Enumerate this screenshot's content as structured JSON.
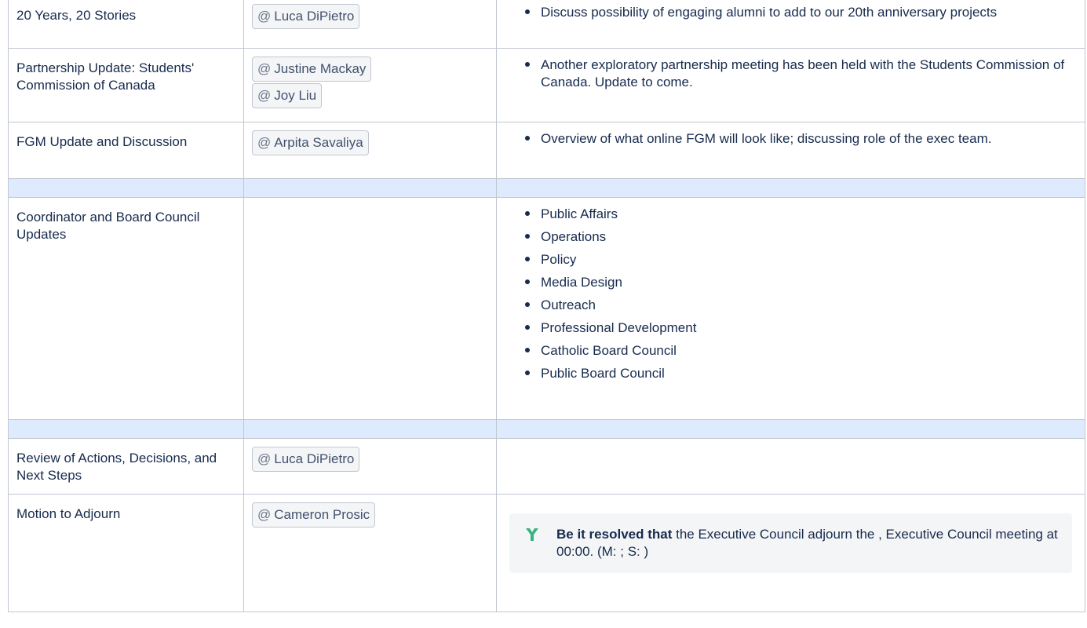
{
  "rows": [
    {
      "topic": "20 Years, 20 Stories",
      "people": [
        "Luca DiPietro"
      ],
      "notes": [
        "Discuss possibility of engaging alumni to add to our 20th anniversary projects"
      ]
    },
    {
      "topic": "Partnership Update: Students' Commission of Canada",
      "people": [
        "Justine Mackay",
        "Joy Liu"
      ],
      "notes": [
        "Another exploratory partnership meeting has been held with the Students Commission of Canada. Update to come."
      ]
    },
    {
      "topic": "FGM Update and Discussion",
      "people": [
        "Arpita Savaliya"
      ],
      "notes": [
        "Overview of what online FGM will look like; discussing role of the exec team."
      ]
    },
    {
      "topic": "Coordinator and Board Council Updates",
      "people": [],
      "notes": [
        "Public Affairs",
        "Operations",
        "Policy",
        "Media Design",
        "Outreach",
        "Professional Development",
        "Catholic Board Council",
        "Public Board Council"
      ]
    },
    {
      "topic": "Review of Actions, Decisions, and Next Steps",
      "people": [
        "Luca DiPietro"
      ],
      "notes": []
    },
    {
      "topic": "Motion to Adjourn",
      "people": [
        "Cameron Prosic"
      ],
      "decision": {
        "bold": "Be it resolved that",
        "text": " the Executive Council adjourn the , Executive Council meeting at 00:00. (M: ; S: )",
        "icon": "decision-icon"
      }
    }
  ],
  "mention_prefix": "@",
  "colors": {
    "separator": "#deebff",
    "border": "#c1c7d0",
    "decision_icon": "#36b37e"
  }
}
